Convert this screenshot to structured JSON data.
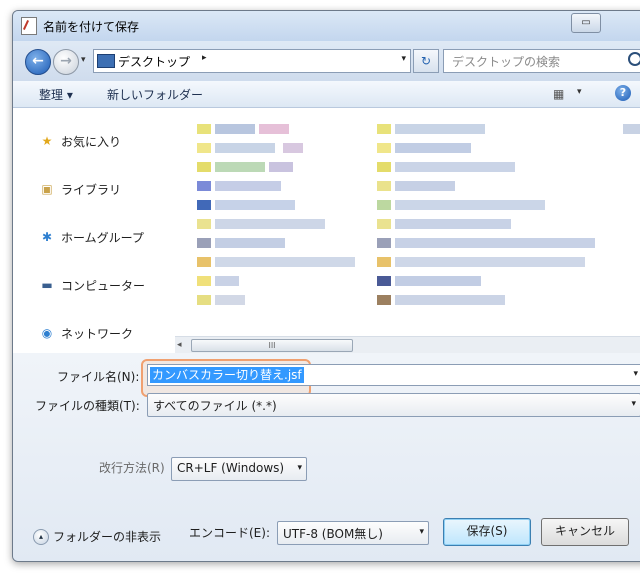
{
  "window": {
    "title": "名前を付けて保存"
  },
  "address_bar": {
    "path": "デスクトップ",
    "search_placeholder": "デスクトップの検索"
  },
  "toolbar": {
    "organize_label": "整理 ▾",
    "new_folder_label": "新しいフォルダー"
  },
  "nav_pane": {
    "items": [
      {
        "label": "お気に入り",
        "icon": "star-icon"
      },
      {
        "label": "ライブラリ",
        "icon": "library-icon"
      },
      {
        "label": "ホームグループ",
        "icon": "homegroup-icon"
      },
      {
        "label": "コンピューター",
        "icon": "computer-icon"
      },
      {
        "label": "ネットワーク",
        "icon": "network-icon"
      }
    ]
  },
  "form": {
    "filename_label": "ファイル名(N):",
    "filename_value": "カンバスカラー切り替え.jsf",
    "filetype_label": "ファイルの種類(T):",
    "filetype_value": "すべてのファイル (*.*)",
    "newline_label": "改行方法(R)",
    "newline_value": "CR+LF (Windows)",
    "encoding_label": "エンコード(E):",
    "encoding_value": "UTF-8 (BOM無し)",
    "save_label": "保存(S)",
    "cancel_label": "キャンセル",
    "hide_folders_label": "フォルダーの非表示"
  },
  "colors": {
    "accent": "#3399ff",
    "highlight_border": "#f0a070",
    "window_frame": "#bcd0e8"
  }
}
